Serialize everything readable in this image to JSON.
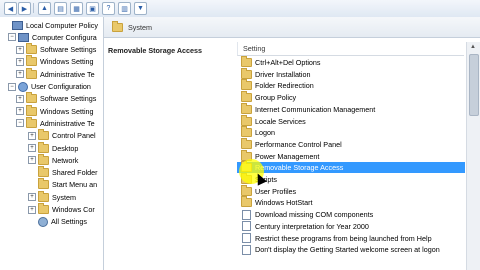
{
  "toolbar": {
    "buttons": [
      "back",
      "forward",
      "up",
      "show-hide",
      "properties",
      "help",
      "filter"
    ]
  },
  "tree": {
    "items": [
      {
        "label": "Local Computer Policy",
        "icon": "pc-icon",
        "expander": ""
      },
      {
        "label": "Computer Configura",
        "icon": "pc-icon",
        "expander": "−"
      },
      {
        "label": "Software Settings",
        "icon": "folder-icon",
        "expander": "+"
      },
      {
        "label": "Windows Setting",
        "icon": "folder-icon",
        "expander": "+"
      },
      {
        "label": "Administrative Te",
        "icon": "folder-icon",
        "expander": "+"
      },
      {
        "label": "User Configuration",
        "icon": "user-icon",
        "expander": "−"
      },
      {
        "label": "Software Settings",
        "icon": "folder-icon",
        "expander": "+"
      },
      {
        "label": "Windows Setting",
        "icon": "folder-icon",
        "expander": "+"
      },
      {
        "label": "Administrative Te",
        "icon": "folder-icon",
        "expander": "−"
      },
      {
        "label": "Control Panel",
        "icon": "folder-icon",
        "expander": "+"
      },
      {
        "label": "Desktop",
        "icon": "folder-icon",
        "expander": "+"
      },
      {
        "label": "Network",
        "icon": "folder-icon",
        "expander": "+"
      },
      {
        "label": "Shared Folder",
        "icon": "folder-icon",
        "expander": ""
      },
      {
        "label": "Start Menu an",
        "icon": "folder-icon",
        "expander": ""
      },
      {
        "label": "System",
        "icon": "folder-icon",
        "expander": "+"
      },
      {
        "label": "Windows Cor",
        "icon": "folder-icon",
        "expander": "+"
      },
      {
        "label": "All Settings",
        "icon": "gear-icon",
        "expander": ""
      }
    ]
  },
  "header": {
    "title": "System"
  },
  "left_title": "Removable Storage Access",
  "list": {
    "column": "Setting",
    "rows": [
      {
        "label": "Ctrl+Alt+Del Options",
        "icon": "folder"
      },
      {
        "label": "Driver Installation",
        "icon": "folder"
      },
      {
        "label": "Folder Redirection",
        "icon": "folder"
      },
      {
        "label": "Group Policy",
        "icon": "folder"
      },
      {
        "label": "Internet Communication Management",
        "icon": "folder"
      },
      {
        "label": "Locale Services",
        "icon": "folder"
      },
      {
        "label": "Logon",
        "icon": "folder"
      },
      {
        "label": "Performance Control Panel",
        "icon": "folder"
      },
      {
        "label": "Power Management",
        "icon": "folder"
      },
      {
        "label": "Removable Storage Access",
        "icon": "folder",
        "selected": true
      },
      {
        "label": "Scripts",
        "icon": "folder"
      },
      {
        "label": "User Profiles",
        "icon": "folder"
      },
      {
        "label": "Windows HotStart",
        "icon": "folder"
      },
      {
        "label": "Download missing COM components",
        "icon": "doc"
      },
      {
        "label": "Century interpretation for Year 2000",
        "icon": "doc"
      },
      {
        "label": "Restrict these programs from being launched from Help",
        "icon": "doc"
      },
      {
        "label": "Don't display the Getting Started welcome screen at logon",
        "icon": "doc"
      }
    ]
  },
  "colors": {
    "selection": "#3399ff",
    "folder": "#e9c86a"
  }
}
